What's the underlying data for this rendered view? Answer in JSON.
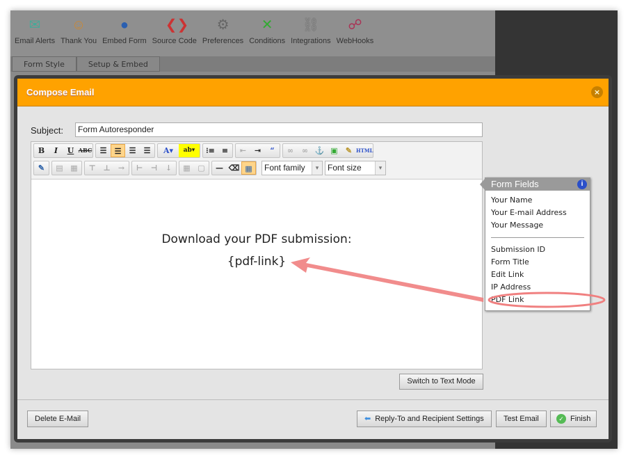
{
  "toolbar": [
    {
      "label": "Email Alerts",
      "icon": "email-alert-icon",
      "glyph": "✉",
      "color": "#4a9"
    },
    {
      "label": "Thank You",
      "icon": "thank-you-icon",
      "glyph": "☺",
      "color": "#c83"
    },
    {
      "label": "Embed Form",
      "icon": "globe-icon",
      "glyph": "●",
      "color": "#2a5fb0"
    },
    {
      "label": "Source Code",
      "icon": "source-code-icon",
      "glyph": "❮❯",
      "color": "#c33"
    },
    {
      "label": "Preferences",
      "icon": "gear-icon",
      "glyph": "⚙",
      "color": "#666"
    },
    {
      "label": "Conditions",
      "icon": "conditions-icon",
      "glyph": "✕",
      "color": "#3a3"
    },
    {
      "label": "Integrations",
      "icon": "link-icon",
      "glyph": "⛓",
      "color": "#777"
    },
    {
      "label": "WebHooks",
      "icon": "webhooks-icon",
      "glyph": "☍",
      "color": "#a35"
    }
  ],
  "tabs": [
    "Form Style",
    "Setup & Embed"
  ],
  "dialog": {
    "title": "Compose Email",
    "subject_label": "Subject:",
    "subject_value": "Form Autoresponder",
    "font_family": "Font family",
    "font_size": "Font size",
    "body_line1": "Download your PDF submission:",
    "body_line2": "{pdf-link}",
    "switch_label": "Switch to Text Mode",
    "delete_label": "Delete E-Mail",
    "reply_label": "Reply-To and Recipient Settings",
    "test_label": "Test Email",
    "finish_label": "Finish"
  },
  "form_fields": {
    "title": "Form Fields",
    "group1": [
      "Your Name",
      "Your E-mail Address",
      "Your Message"
    ],
    "group2": [
      "Submission ID",
      "Form Title",
      "Edit Link",
      "IP Address",
      "PDF Link"
    ],
    "highlighted": "PDF Link"
  },
  "colors": {
    "header": "#ffa200",
    "annotation": "#f08080"
  }
}
